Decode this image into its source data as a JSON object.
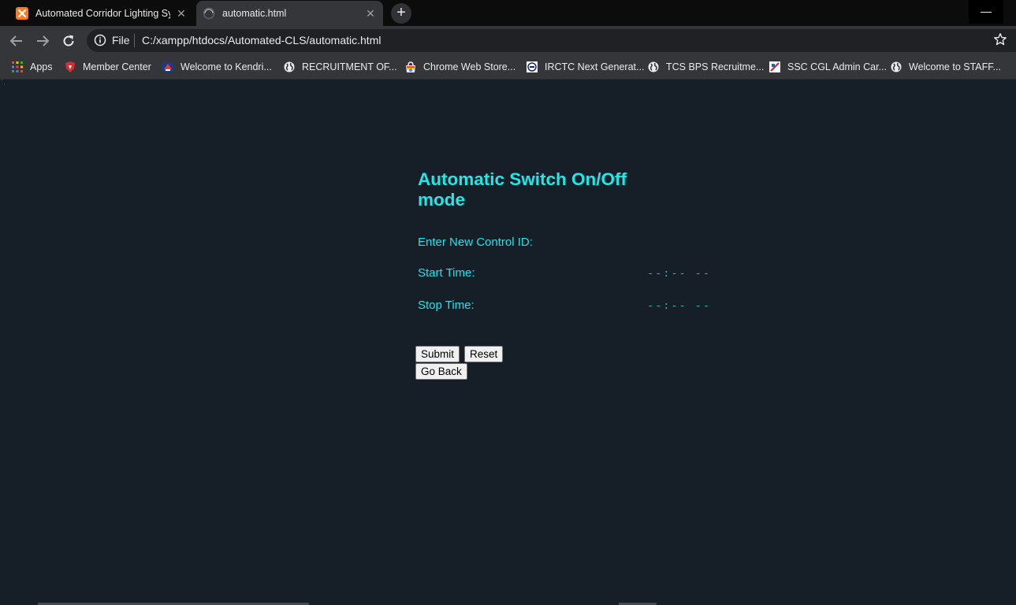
{
  "browser": {
    "tabs": [
      {
        "title": "Automated Corridor Lighting Sys",
        "icon": "xampp-icon",
        "active": false
      },
      {
        "title": "automatic.html",
        "icon": "globe-icon",
        "active": true
      }
    ],
    "new_tab_label": "+",
    "minimize_label": "—",
    "address": {
      "scheme_label": "File",
      "url": "C:/xampp/htdocs/Automated-CLS/automatic.html"
    },
    "bookmarks": [
      {
        "label": "Apps",
        "icon": "apps-grid-icon"
      },
      {
        "label": "Member Center",
        "icon": "msi-shield-icon"
      },
      {
        "label": "Welcome to Kendri...",
        "icon": "kv-logo-icon"
      },
      {
        "label": "RECRUITMENT OF...",
        "icon": "globe-icon"
      },
      {
        "label": "Chrome Web Store...",
        "icon": "web-store-icon"
      },
      {
        "label": "IRCTC Next Generat...",
        "icon": "irctc-icon"
      },
      {
        "label": "TCS BPS Recruitme...",
        "icon": "globe-icon"
      },
      {
        "label": "SSC CGL Admin Car...",
        "icon": "ssc-icon"
      },
      {
        "label": "Welcome to STAFF...",
        "icon": "globe-icon"
      }
    ]
  },
  "page": {
    "corner_mark": "\",",
    "heading": "Automatic Switch On/Off mode",
    "control_id_label": "Enter New Control ID:",
    "start_time_label": "Start Time:",
    "start_time_value": "--:-- --",
    "stop_time_label": "Stop Time:",
    "stop_time_value": "--:-- --",
    "submit_label": "Submit",
    "reset_label": "Reset",
    "go_back_label": "Go Back"
  },
  "colors": {
    "page_background": "#161e27",
    "accent_text": "#1de9e9",
    "chrome_dark": "#35363a"
  }
}
